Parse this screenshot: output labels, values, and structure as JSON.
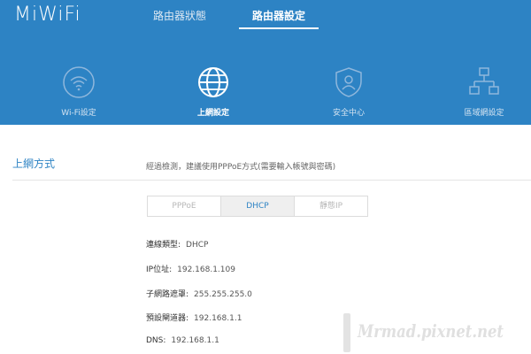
{
  "header": {
    "logo": "MiWiFi",
    "tabs": [
      {
        "label": "路由器狀態"
      },
      {
        "label": "路由器設定",
        "active": true
      }
    ]
  },
  "nav": {
    "items": [
      {
        "label": "Wi-Fi設定",
        "icon": "wifi-icon"
      },
      {
        "label": "上網設定",
        "icon": "globe-icon",
        "active": true
      },
      {
        "label": "安全中心",
        "icon": "shield-user-icon"
      },
      {
        "label": "區域網設定",
        "icon": "lan-icon"
      }
    ]
  },
  "section": {
    "title": "上網方式",
    "description": "經過檢測，建議使用PPPoE方式(需要輸入帳號與密碼)"
  },
  "connection_modes": {
    "options": [
      "PPPoE",
      "DHCP",
      "靜態IP"
    ],
    "selected": "DHCP"
  },
  "info": {
    "type_label": "連線類型:",
    "type_value": "DHCP",
    "ip_label": "IP位址:",
    "ip_value": "192.168.1.109",
    "mask_label": "子網路遮罩:",
    "mask_value": "255.255.255.0",
    "gateway_label": "預設閘道器:",
    "gateway_value": "192.168.1.1",
    "dns_label": "DNS:",
    "dns_value": "192.168.1.1"
  },
  "watermark": "Mrmad.pixnet.net",
  "colors": {
    "header_bg": "#2d83c4",
    "accent": "#2d83c4"
  }
}
